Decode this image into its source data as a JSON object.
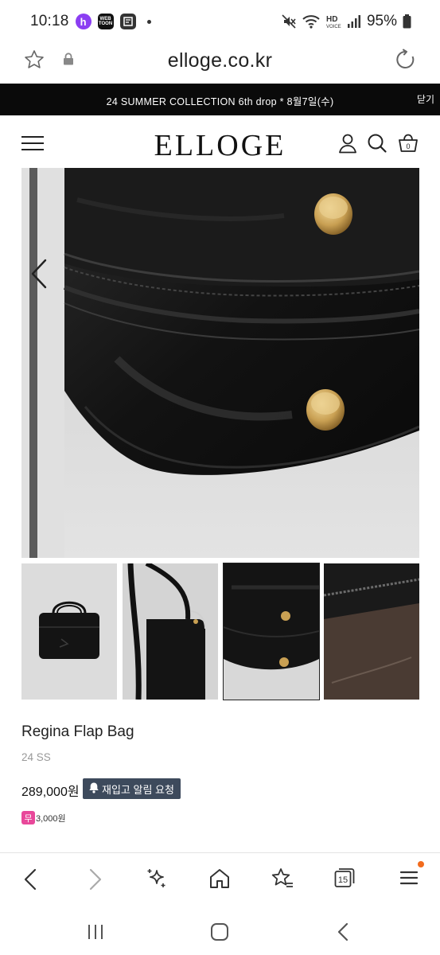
{
  "status_bar": {
    "time": "10:18",
    "notification_icons": [
      "h-app-icon",
      "webtoon-icon",
      "flag-icon"
    ],
    "webtoon_text": "WEB TOON",
    "h_text": "h",
    "battery": "95%"
  },
  "browser": {
    "url": "elloge.co.kr",
    "tabs_count": "15"
  },
  "announcement": {
    "text": "24 SUMMER COLLECTION 6th drop * 8월7일(수)",
    "close_label": "닫기"
  },
  "site": {
    "logo": "ELLOGE"
  },
  "gallery": {
    "thumbnails": [
      "thumb-front",
      "thumb-side",
      "thumb-corner",
      "thumb-interior"
    ],
    "active_index": 2
  },
  "product": {
    "name": "Regina Flap Bag",
    "season": "24 SS",
    "price": "289,000원",
    "restock_label": "재입고 알림 요청",
    "shipping_badge": "무",
    "shipping_fee": "3,000원"
  },
  "colors": {
    "banner_bg": "#0a0a0a",
    "restock_bg": "#3d4a5c",
    "shipping_badge": "#e8489a",
    "menu_dot": "#f26b1d",
    "h_app": "#8b3ef2"
  }
}
